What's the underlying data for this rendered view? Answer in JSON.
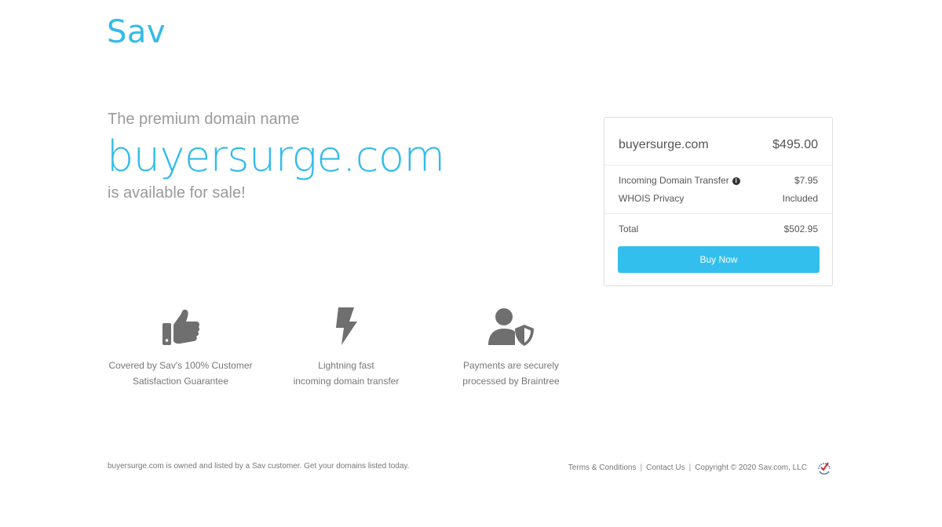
{
  "brand": {
    "logo": "Sav"
  },
  "hero": {
    "pre": "The premium domain name",
    "domain": "buyersurge.com",
    "post": "is available for sale!"
  },
  "card": {
    "domain": "buyersurge.com",
    "price": "$495.00",
    "transfer_label": "Incoming Domain Transfer",
    "transfer_price": "$7.95",
    "whois_label": "WHOIS Privacy",
    "whois_value": "Included",
    "total_label": "Total",
    "total_value": "$502.95",
    "buy_label": "Buy Now"
  },
  "features": [
    {
      "icon": "thumbs-up-icon",
      "line1": "Covered by Sav's 100% Customer",
      "line2": "Satisfaction Guarantee"
    },
    {
      "icon": "lightning-icon",
      "line1": "Lightning fast",
      "line2": "incoming domain transfer"
    },
    {
      "icon": "user-shield-icon",
      "line1": "Payments are securely",
      "line2": "processed by Braintree"
    }
  ],
  "footer": {
    "left": "buyersurge.com is owned and listed by a Sav customer. Get your domains listed today.",
    "terms": "Terms & Conditions",
    "contact": "Contact Us",
    "copyright": "Copyright © 2020 Sav.com, LLC",
    "seal_icon": "security-seal-icon"
  },
  "colors": {
    "accent": "#33bbe9",
    "button": "#33bfee",
    "icon_gray": "#6f6f6f"
  }
}
